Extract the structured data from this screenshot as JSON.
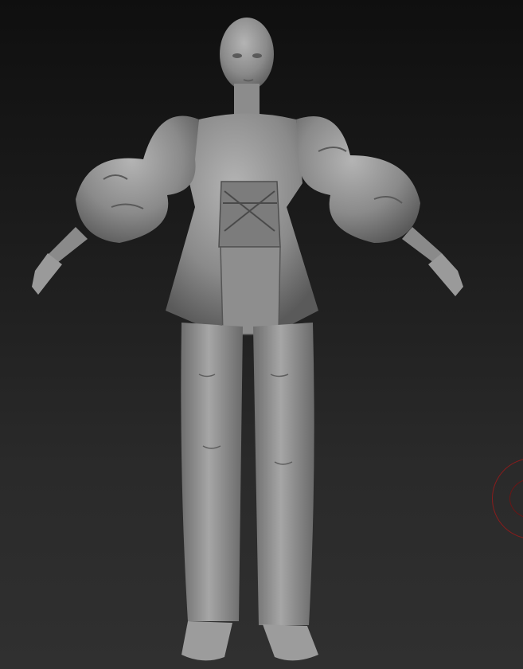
{
  "viewport": {
    "background_top": "#0f0f0f",
    "background_bottom": "#303030",
    "model_color": "#8a8a8a",
    "gizmo_color": "#8a1c1c",
    "subject": "sculpted-female-figure-icon",
    "gizmo": "rotate-gizmo-icon"
  }
}
